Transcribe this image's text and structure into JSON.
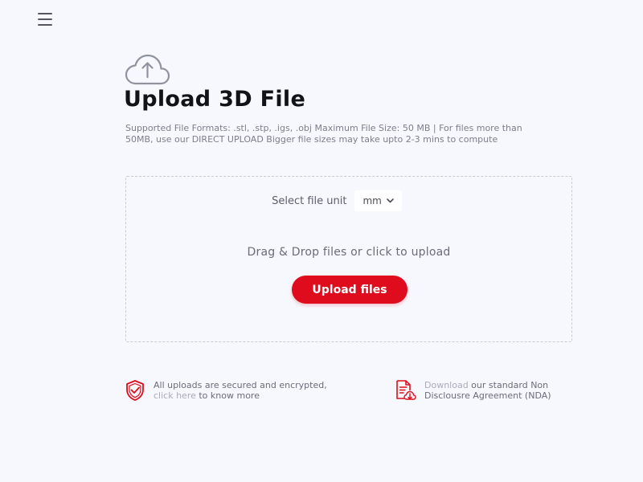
{
  "header": {
    "menu_icon": "hamburger-menu-icon"
  },
  "hero": {
    "icon": "cloud-upload-icon",
    "title": "Upload 3D File",
    "supported_formats": "Supported File Formats: .stl, .stp, .igs, .obj  Maximum File Size: 50 MB | For files more than 50MB, use our DIRECT UPLOAD Bigger file sizes may take upto 2-3 mins to compute"
  },
  "dropzone": {
    "unit_label": "Select file unit",
    "unit_value": "mm",
    "drag_text": "Drag & Drop files or click to upload",
    "upload_button_label": "Upload files"
  },
  "footer": {
    "security": {
      "icon": "shield-check-icon",
      "line1": "All uploads are secured and encrypted,",
      "link_text": "click here",
      "line2_rest": " to know more"
    },
    "nda": {
      "icon": "document-download-icon",
      "link_text": "Download",
      "line1_rest": " our standard Non",
      "line2": "Disclousre Agreement (NDA)"
    }
  },
  "colors": {
    "background": "#f7f8fd",
    "accent": "#de0c1c",
    "title": "#121316",
    "link": "#a8acb8"
  }
}
